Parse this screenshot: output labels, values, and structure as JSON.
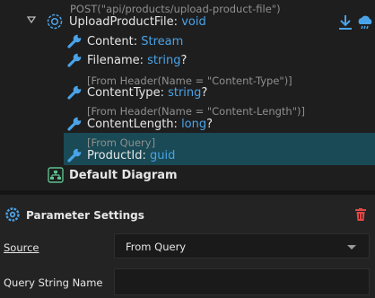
{
  "operation": {
    "route_attr": "POST(\"api/products/upload-product-file\")",
    "name": "UploadProductFile",
    "sep": ": ",
    "return_type": "void"
  },
  "params": [
    {
      "attr": "",
      "name": "Content",
      "type": "Stream",
      "nullable": ""
    },
    {
      "attr": "",
      "name": "Filename",
      "type": "string",
      "nullable": "?"
    },
    {
      "attr": "[From Header(Name = \"Content-Type\")]",
      "name": "ContentType",
      "type": "string",
      "nullable": "?"
    },
    {
      "attr": "[From Header(Name = \"Content-Length\")]",
      "name": "ContentLength",
      "type": "long",
      "nullable": "?"
    },
    {
      "attr": "[From Query]",
      "name": "ProductId",
      "type": "guid",
      "nullable": ""
    }
  ],
  "diagram": {
    "label": "Default Diagram"
  },
  "panel": {
    "title": "Parameter Settings",
    "source_label": "Source",
    "source_value": "From Query",
    "query_label": "Query String Name",
    "query_value": ""
  },
  "icons": {
    "expand": "triangle-down-icon",
    "operation": "operation-gear-icon",
    "parameter": "wrench-icon",
    "diagram": "diagram-icon",
    "download": "download-arrow-icon",
    "cloud": "cloud-icon",
    "settings": "gear-icon",
    "delete": "trash-icon"
  },
  "colors": {
    "accent": "#4aa3e8",
    "selection": "#194a55",
    "delete": "#e04848"
  }
}
